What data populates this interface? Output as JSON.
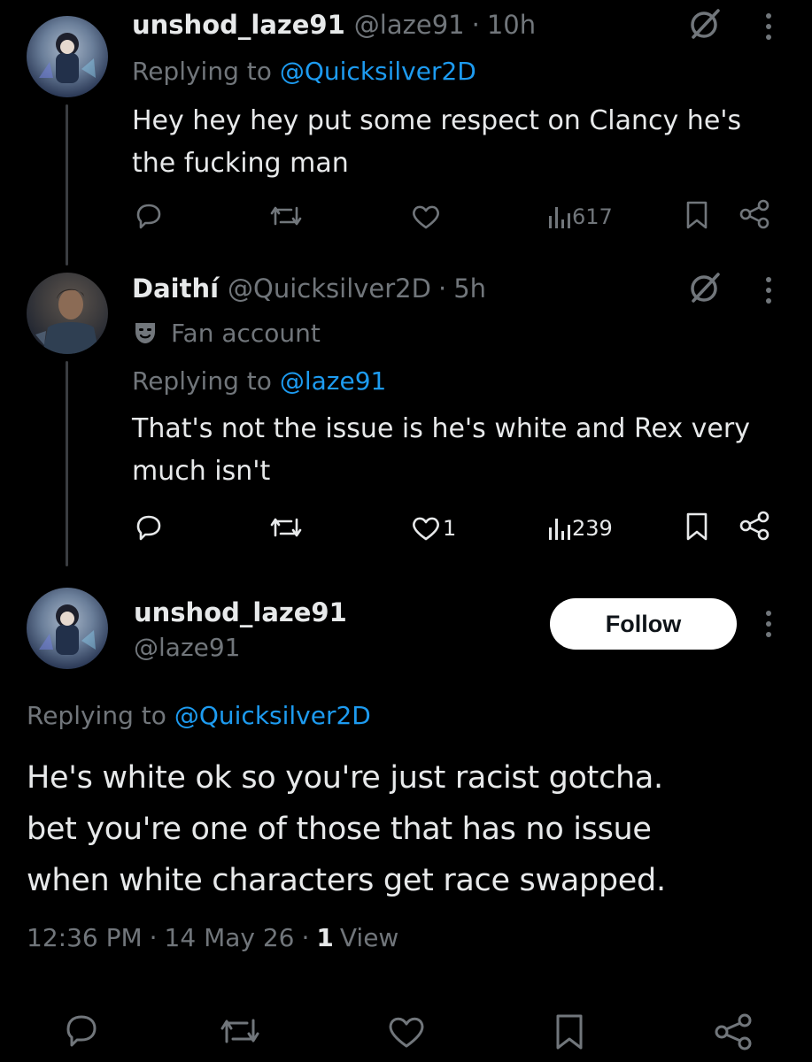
{
  "tweet1": {
    "display_name": "unshod_laze91",
    "handle": "@laze91",
    "sep": "·",
    "time": "10h",
    "reply_prefix": "Replying to",
    "reply_to": "@Quicksilver2D",
    "text_line1": "Hey hey hey put some respect on Clancy he's",
    "text_line2": "the fucking man",
    "likes": "",
    "views": "617"
  },
  "tweet2": {
    "display_name": "Daithí",
    "handle": "@Quicksilver2D",
    "sep": "·",
    "time": "5h",
    "badge_label": "Fan account",
    "reply_prefix": "Replying to",
    "reply_to": "@laze91",
    "text_line1": "That's not the issue is he's white and Rex very",
    "text_line2": "much isn't",
    "likes": "1",
    "views": "239"
  },
  "main_tweet": {
    "display_name": "unshod_laze91",
    "handle": "@laze91",
    "follow_label": "Follow",
    "reply_prefix": "Replying to",
    "reply_to": "@Quicksilver2D",
    "text_line1": "He's white ok so you're just racist gotcha.",
    "text_line2": "bet you're one of those that has no issue",
    "text_line3": "when white characters get race swapped.",
    "time": "12:36 PM",
    "sep1": "·",
    "date": "14 May 26",
    "sep2": "·",
    "view_count": "1",
    "view_label": "View"
  },
  "colors": {
    "background": "#000000",
    "text": "#e7e9ea",
    "muted": "#71767b",
    "link": "#1d9bf0",
    "thread_line": "#3a3d41"
  },
  "icons": [
    "grok-icon",
    "more-vertical-icon",
    "reply-icon",
    "retweet-icon",
    "like-icon",
    "views-icon",
    "bookmark-icon",
    "share-icon",
    "mask-icon"
  ]
}
